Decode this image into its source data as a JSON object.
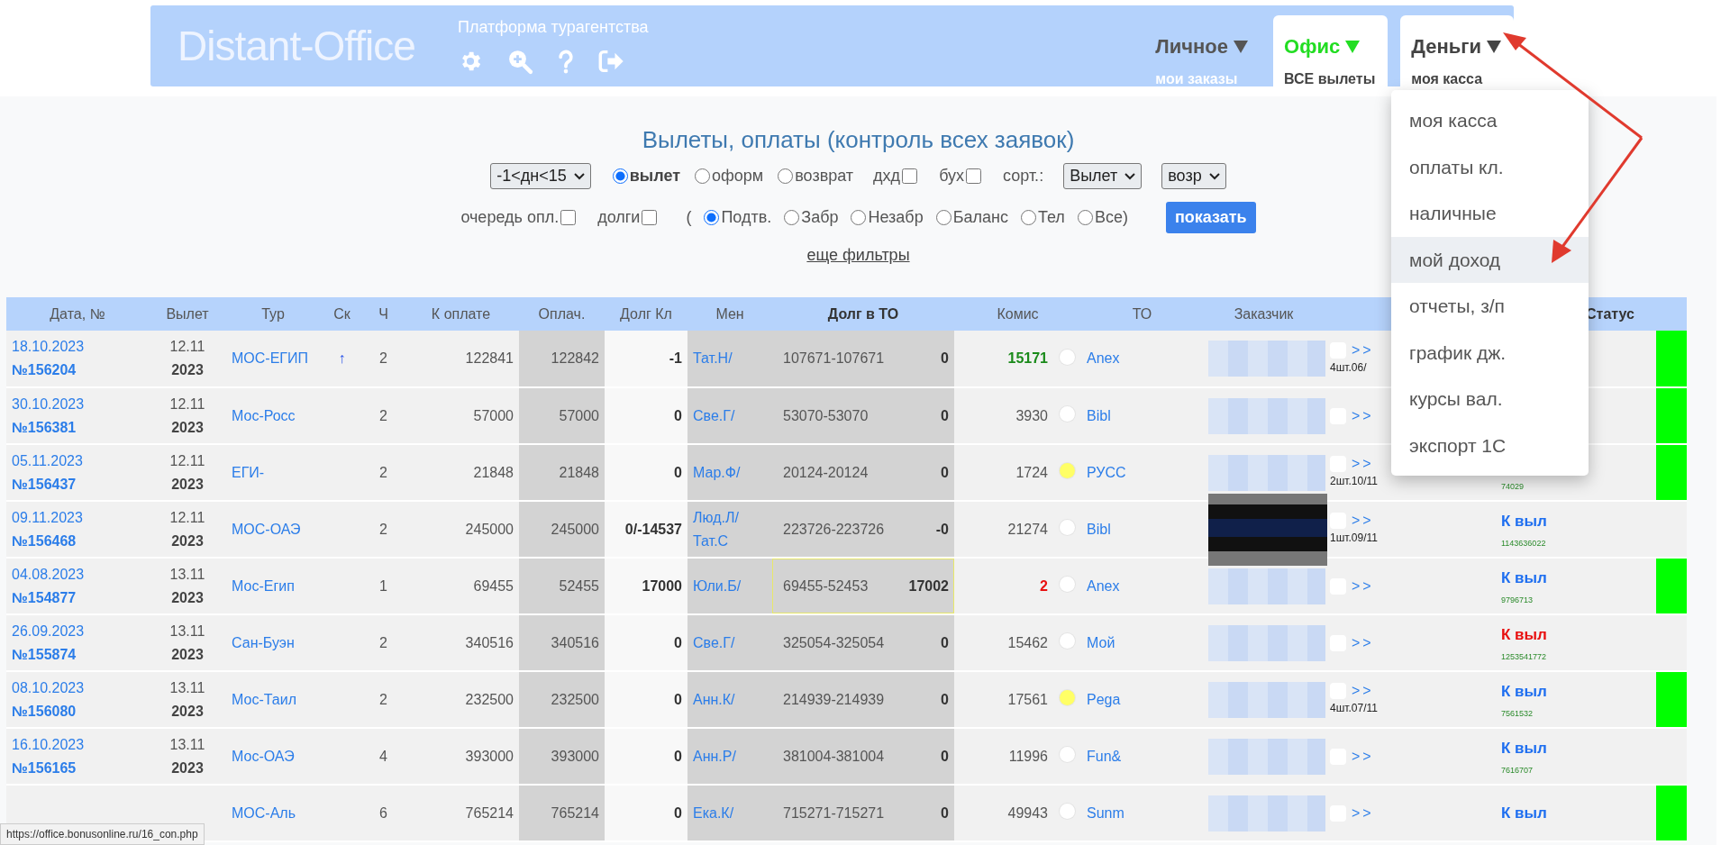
{
  "header": {
    "logo": "Distant-Office",
    "subtitle": "Платформа турагентства",
    "menus": [
      {
        "title": "Личное",
        "subtitle": "мои заказы",
        "color": "#555555",
        "active": false
      },
      {
        "title": "Офис",
        "subtitle": "ВСЕ вылеты",
        "color": "#22dd22",
        "active": true
      },
      {
        "title": "Деньги",
        "subtitle": "моя касса",
        "color": "#444444",
        "active": true
      }
    ]
  },
  "dropdown": {
    "items": [
      {
        "label": "моя касса",
        "selected": false
      },
      {
        "label": "оплаты кл.",
        "selected": false
      },
      {
        "label": "наличные",
        "selected": false
      },
      {
        "label": "мой доход",
        "selected": true
      },
      {
        "label": "отчеты, з/п",
        "selected": false
      },
      {
        "label": "график дж.",
        "selected": false
      },
      {
        "label": "курсы вал.",
        "selected": false
      },
      {
        "label": "экспорт 1С",
        "selected": false
      }
    ]
  },
  "filters": {
    "title": "Вылеты, оплаты (контроль всех заявок)",
    "period": "-1<дн<15",
    "date_type": [
      {
        "label": "вылет",
        "selected": true
      },
      {
        "label": "оформ",
        "selected": false
      },
      {
        "label": "возврат",
        "selected": false
      }
    ],
    "flags": [
      {
        "label": "дхд",
        "checked": false
      },
      {
        "label": "бух",
        "checked": false
      }
    ],
    "sort_label": "сорт.:",
    "sort_field": "Вылет",
    "sort_order": "возр",
    "flags2": [
      {
        "label": "очередь опл.",
        "checked": false
      },
      {
        "label": "долги",
        "checked": false
      }
    ],
    "open_paren": "(",
    "status": [
      {
        "label": "Подтв.",
        "selected": true
      },
      {
        "label": "Забр",
        "selected": false
      },
      {
        "label": "Незабр",
        "selected": false
      },
      {
        "label": "Баланс",
        "selected": false
      },
      {
        "label": "Тел",
        "selected": false
      },
      {
        "label": "Все)",
        "selected": false
      }
    ],
    "show_button": "показать",
    "more_link": "еще фильтры"
  },
  "table": {
    "columns": [
      "Дата, №",
      "Вылет",
      "Тур",
      "Ск",
      "Ч",
      "К оплате",
      "Оплач.",
      "Долг Кл",
      "Мен",
      "Долг в ТО",
      "Комис",
      "ТО",
      "Заказчик",
      "Статус"
    ],
    "rows": [
      {
        "date": "18.10.2023",
        "num": "№156204",
        "dep": "12.11",
        "year": "2023",
        "tour": "МОС-ЕГИП",
        "sk": "↑",
        "ch": "2",
        "to_pay": "122841",
        "paid": "122842",
        "debt": "-1",
        "men": [
          "Тат.Н/"
        ],
        "to_range": "107671-107671",
        "to_debt": "0",
        "highlighted": false,
        "commission": {
          "value": "15171",
          "color": "#1a8a1a"
        },
        "color": "#ffffff",
        "operator": "Anex",
        "customer": {
          "kind": "light"
        },
        "checked": false,
        "more": ">>",
        "count": "4шт.06/",
        "flagged": true
      },
      {
        "date": "30.10.2023",
        "num": "№156381",
        "dep": "12.11",
        "year": "2023",
        "tour": "Мос-Росс",
        "ch": "2",
        "to_pay": "57000",
        "paid": "57000",
        "debt": "0",
        "men": [
          "Све.Г/"
        ],
        "to_range": "53070-53070",
        "to_debt": "0",
        "highlighted": false,
        "commission": {
          "value": "3930",
          "color": "#555555"
        },
        "color": "#ffffff",
        "operator": "Bibl",
        "customer": {
          "kind": "light"
        },
        "checked": false,
        "more": ">>",
        "flagged": true
      },
      {
        "date": "05.11.2023",
        "num": "№156437",
        "dep": "12.11",
        "year": "2023",
        "tour": "ЕГИ-",
        "ch": "2",
        "to_pay": "21848",
        "paid": "21848",
        "debt": "0",
        "men": [
          "Мар.Ф/"
        ],
        "to_range": "20124-20124",
        "to_debt": "0",
        "highlighted": false,
        "commission": {
          "value": "1724",
          "color": "#555555"
        },
        "color": "#ffff66",
        "operator": "РУСС",
        "customer": {
          "kind": "light"
        },
        "checked": false,
        "more": ">>",
        "count": "2шт.10/11",
        "code": "74029",
        "flagged": true
      },
      {
        "date": "09.11.2023",
        "num": "№156468",
        "dep": "12.11",
        "year": "2023",
        "tour": "МОС-ОАЭ",
        "ch": "2",
        "to_pay": "245000",
        "paid": "245000",
        "debt": "0/-14537",
        "men": [
          "Люд.Л/",
          "Тат.С"
        ],
        "to_range": "223726-223726",
        "to_debt": "-0",
        "highlighted": false,
        "commission": {
          "value": "21274",
          "color": "#555555"
        },
        "color": "#ffffff",
        "operator": "Bibl",
        "customer": {
          "kind": "dark"
        },
        "checked": false,
        "more": ">>",
        "count": "1шт.09/11",
        "status": {
          "text": "К выл",
          "color": "#1f6ff0"
        },
        "code": "1143636022",
        "flagged": false
      },
      {
        "date": "04.08.2023",
        "num": "№154877",
        "dep": "13.11",
        "year": "2023",
        "tour": "Мос-Егип",
        "ch": "1",
        "to_pay": "69455",
        "paid": "52455",
        "debt": "17000",
        "men": [
          "Юли.Б/"
        ],
        "to_range": "69455-52453",
        "to_debt": "17002",
        "highlighted": true,
        "commission": {
          "value": "2",
          "color": "#e81010"
        },
        "color": "#ffffff",
        "operator": "Anex",
        "customer": {
          "kind": "light"
        },
        "checked": false,
        "more": ">>",
        "status": {
          "text": "К выл",
          "color": "#1f6ff0"
        },
        "code": "9796713",
        "flagged": true
      },
      {
        "date": "26.09.2023",
        "num": "№155874",
        "dep": "13.11",
        "year": "2023",
        "tour": "Сан-Буэн",
        "ch": "2",
        "to_pay": "340516",
        "paid": "340516",
        "debt": "0",
        "men": [
          "Све.Г/"
        ],
        "to_range": "325054-325054",
        "to_debt": "0",
        "highlighted": false,
        "commission": {
          "value": "15462",
          "color": "#555555"
        },
        "color": "#ffffff",
        "operator": "Мой",
        "customer": {
          "kind": "light"
        },
        "checked": false,
        "more": ">>",
        "status": {
          "text": "К выл",
          "color": "#e81010"
        },
        "code": "1253541772",
        "flagged": false
      },
      {
        "date": "08.10.2023",
        "num": "№156080",
        "dep": "13.11",
        "year": "2023",
        "tour": "Мос-Таил",
        "ch": "2",
        "to_pay": "232500",
        "paid": "232500",
        "debt": "0",
        "men": [
          "Анн.К/"
        ],
        "to_range": "214939-214939",
        "to_debt": "0",
        "highlighted": false,
        "commission": {
          "value": "17561",
          "color": "#555555"
        },
        "color": "#ffff66",
        "operator": "Pega",
        "customer": {
          "kind": "light"
        },
        "checked": false,
        "more": ">>",
        "count": "4шт.07/11",
        "status": {
          "text": "К выл",
          "color": "#1f6ff0"
        },
        "code": "7561532",
        "flagged": true
      },
      {
        "date": "16.10.2023",
        "num": "№156165",
        "dep": "13.11",
        "year": "2023",
        "tour": "Мос-ОАЭ",
        "ch": "4",
        "to_pay": "393000",
        "paid": "393000",
        "debt": "0",
        "men": [
          "Анн.Р/"
        ],
        "to_range": "381004-381004",
        "to_debt": "0",
        "highlighted": false,
        "commission": {
          "value": "11996",
          "color": "#555555"
        },
        "color": "#ffffff",
        "operator": "Fun&",
        "customer": {
          "kind": "light"
        },
        "checked": false,
        "more": ">>",
        "status": {
          "text": "К выл",
          "color": "#1f6ff0"
        },
        "code": "7616707",
        "flagged": false
      },
      {
        "tour": "МОС-Аль",
        "ch": "6",
        "to_pay": "765214",
        "paid": "765214",
        "debt": "0",
        "men": [
          "Ека.К/"
        ],
        "to_range": "715271-715271",
        "to_debt": "0",
        "highlighted": false,
        "commission": {
          "value": "49943",
          "color": "#555555"
        },
        "color": "#ffffff",
        "operator": "Sunm",
        "customer": {
          "kind": "light"
        },
        "checked": false,
        "more": ">>",
        "status": {
          "text": "К выл",
          "color": "#1f6ff0"
        },
        "flagged": true
      }
    ]
  },
  "status_url": "https://office.bonusonline.ru/16_con.php"
}
